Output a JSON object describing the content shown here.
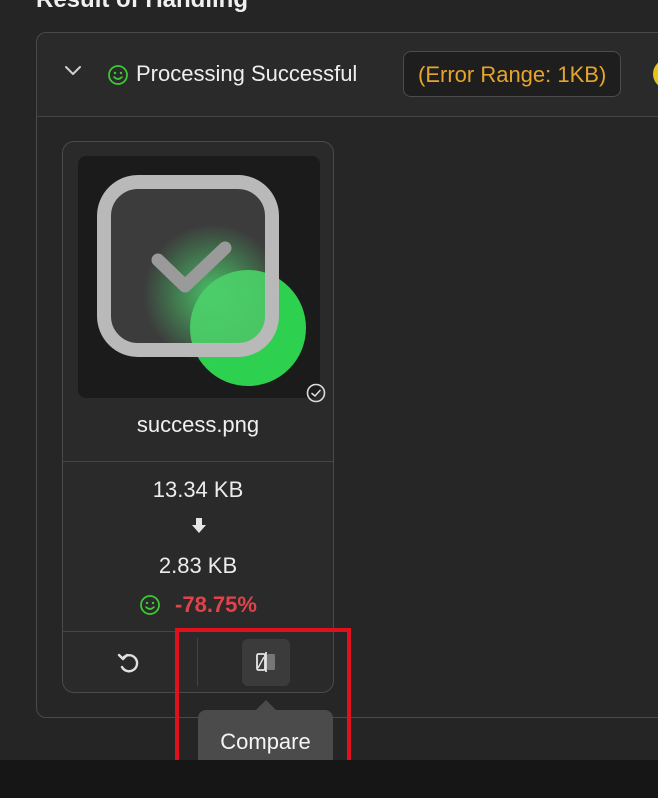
{
  "section": {
    "title": "Result of Handling"
  },
  "result": {
    "status_text": "Processing Successful",
    "error_range": "(Error Range: 1KB)"
  },
  "file_card": {
    "file_name": "success.png",
    "original_size": "13.34 KB",
    "compressed_size": "2.83 KB",
    "reduction": "-78.75%"
  },
  "tooltip": {
    "text": "Compare"
  },
  "colors": {
    "accent_orange": "#e6a52a",
    "success_green": "#3cc832",
    "reduction_red": "#e0444a",
    "highlight_red": "#e0111c"
  },
  "icons": [
    "chevron-down-icon",
    "smile-icon",
    "check-circle-icon",
    "arrow-down-icon",
    "undo-icon",
    "compare-icon"
  ]
}
